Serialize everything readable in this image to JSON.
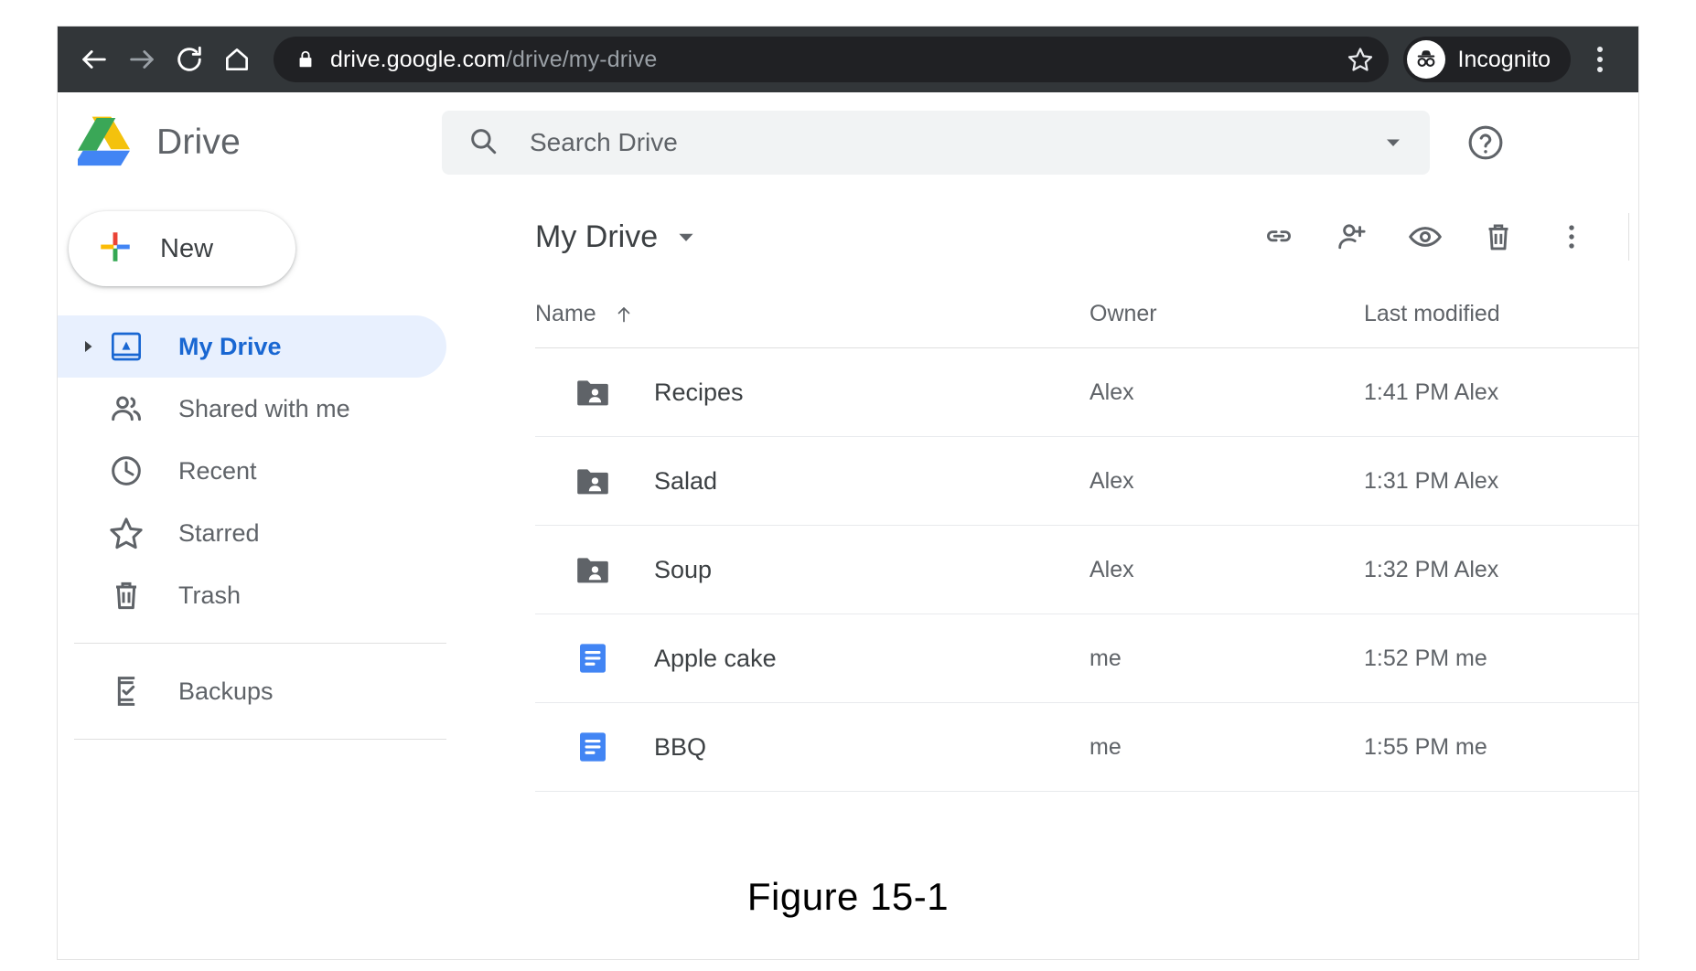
{
  "browser": {
    "back_icon": "arrow-left-icon",
    "forward_icon": "arrow-right-icon",
    "reload_icon": "reload-icon",
    "home_icon": "home-icon",
    "lock_icon": "lock-icon",
    "url_domain": "drive.google.com",
    "url_path": "/drive/my-drive",
    "star_icon": "star-icon",
    "incognito_label": "Incognito",
    "incognito_icon": "incognito-hat-glasses-icon",
    "menu_icon": "three-dot-menu-icon"
  },
  "header": {
    "logo_icon": "google-drive-logo",
    "brand": "Drive",
    "search": {
      "icon": "search-icon",
      "placeholder": "Search Drive",
      "caret_icon": "chevron-down-icon"
    },
    "help_icon": "help-circle-icon"
  },
  "sidebar": {
    "new_button": {
      "label": "New",
      "icon": "plus-icon"
    },
    "items": [
      {
        "label": "My Drive",
        "icon": "my-drive-icon",
        "active": true,
        "expandable": true
      },
      {
        "label": "Shared with me",
        "icon": "people-icon",
        "active": false,
        "expandable": false
      },
      {
        "label": "Recent",
        "icon": "clock-icon",
        "active": false,
        "expandable": false
      },
      {
        "label": "Starred",
        "icon": "star-outline-icon",
        "active": false,
        "expandable": false
      },
      {
        "label": "Trash",
        "icon": "trash-icon",
        "active": false,
        "expandable": false
      }
    ],
    "secondary_items": [
      {
        "label": "Backups",
        "icon": "backup-phone-icon"
      }
    ]
  },
  "main": {
    "breadcrumb": "My Drive",
    "breadcrumb_caret_icon": "chevron-down-icon",
    "toolbar_icons": [
      "link-icon",
      "add-person-icon",
      "eye-icon",
      "trash-icon",
      "three-dot-menu-icon"
    ],
    "columns": {
      "name": "Name",
      "name_sort_icon": "arrow-up-icon",
      "owner": "Owner",
      "modified": "Last modified"
    },
    "rows": [
      {
        "name": "Recipes",
        "type": "shared-folder",
        "owner": "Alex",
        "modified": "1:41 PM Alex"
      },
      {
        "name": "Salad",
        "type": "shared-folder",
        "owner": "Alex",
        "modified": "1:31 PM Alex"
      },
      {
        "name": "Soup",
        "type": "shared-folder",
        "owner": "Alex",
        "modified": "1:32 PM Alex"
      },
      {
        "name": "Apple cake",
        "type": "google-doc",
        "owner": "me",
        "modified": "1:52 PM me"
      },
      {
        "name": "BBQ",
        "type": "google-doc",
        "owner": "me",
        "modified": "1:55 PM me"
      }
    ]
  },
  "caption": "Figure 15-1",
  "colors": {
    "chrome_bar": "#323639",
    "omnibox": "#202124",
    "drive_blue": "#1967d2",
    "active_pill": "#e8f0fe",
    "doc_blue": "#4285f4",
    "folder_gray": "#5f6368",
    "text_gray": "#5f6368"
  }
}
